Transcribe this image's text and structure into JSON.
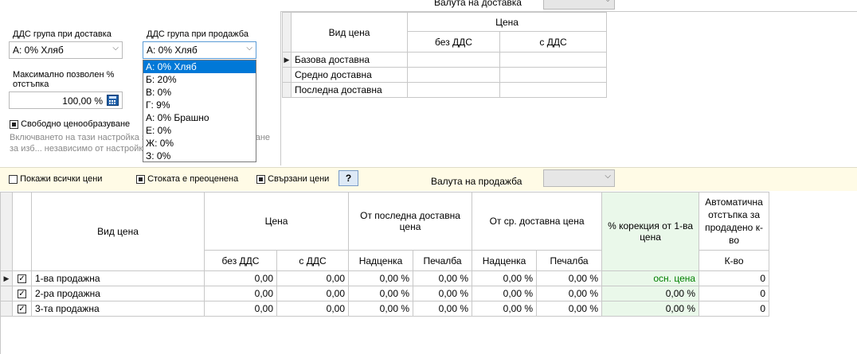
{
  "delivery": {
    "vat_label": "ДДС група при доставка",
    "vat_value": "А: 0% Хляб",
    "currency_label": "Валута на доставка",
    "currency_value": ""
  },
  "sale": {
    "vat_label": "ДДС група при продажба",
    "vat_value": "А: 0% Хляб",
    "vat_options": [
      "А: 0% Хляб",
      "Б: 20%",
      "В: 0%",
      "Г: 9%",
      "А: 0% Брашно",
      "Е: 0%",
      "Ж: 0%",
      "З: 0%"
    ],
    "currency_label": "Валута на продажба",
    "currency_value": ""
  },
  "discount": {
    "label": "Максимално позволен % отстъпка",
    "value": "100,00 %"
  },
  "free_pricing": {
    "label": "Свободно ценообразуване",
    "checked": true,
    "description": "Включването на тази настройка за ... свободно ценообразуване за изб... независимо от настройките в м..."
  },
  "options_bar": {
    "show_all_prices": "Покажи всички цени",
    "item_revalued": "Стоката е преоценена",
    "linked_prices": "Свързани цени",
    "help_button": "?"
  },
  "delivery_grid": {
    "col_type": "Вид цена",
    "col_price": "Цена",
    "col_no_vat": "без ДДС",
    "col_with_vat": "с ДДС",
    "rows": [
      {
        "name": "Базова доставна",
        "no_vat": "",
        "with_vat": ""
      },
      {
        "name": "Средно доставна",
        "no_vat": "",
        "with_vat": ""
      },
      {
        "name": "Последна доставна",
        "no_vat": "",
        "with_vat": ""
      }
    ]
  },
  "sale_grid": {
    "col_type": "Вид цена",
    "col_price": "Цена",
    "col_from_last": "От последна доставна цена",
    "col_from_avg": "От ср. доставна цена",
    "col_correction": "% корекция от 1-ва цена",
    "col_auto_discount": "Автоматична отстъпка за продадено к-во",
    "sub_no_vat": "без ДДС",
    "sub_with_vat": "с ДДС",
    "sub_markup": "Надценка",
    "sub_profit": "Печалба",
    "sub_qty": "К-во",
    "rows": [
      {
        "name": "1-ва продажна",
        "no_vat": "0,00",
        "with_vat": "0,00",
        "last_markup": "0,00 %",
        "last_profit": "0,00 %",
        "avg_markup": "0,00 %",
        "avg_profit": "0,00 %",
        "correction": "осн. цена",
        "qty": "0"
      },
      {
        "name": "2-ра продажна",
        "no_vat": "0,00",
        "with_vat": "0,00",
        "last_markup": "0,00 %",
        "last_profit": "0,00 %",
        "avg_markup": "0,00 %",
        "avg_profit": "0,00 %",
        "correction": "0,00 %",
        "qty": "0"
      },
      {
        "name": "3-та продажна",
        "no_vat": "0,00",
        "with_vat": "0,00",
        "last_markup": "0,00 %",
        "last_profit": "0,00 %",
        "avg_markup": "0,00 %",
        "avg_profit": "0,00 %",
        "correction": "0,00 %",
        "qty": "0"
      }
    ]
  },
  "colors": {
    "options_bar_bg": "#fffbe6",
    "correction_bg": "#eaf8ea",
    "correction_text": "#008000",
    "highlight": "#0078d7"
  }
}
